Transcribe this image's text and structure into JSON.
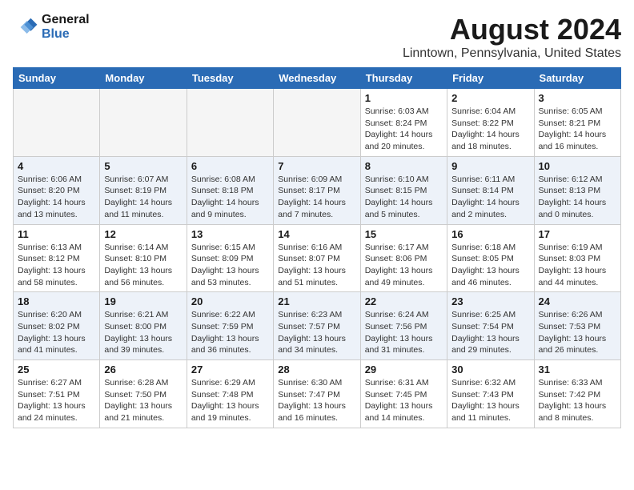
{
  "header": {
    "logo_line1": "General",
    "logo_line2": "Blue",
    "title": "August 2024",
    "subtitle": "Linntown, Pennsylvania, United States"
  },
  "days_of_week": [
    "Sunday",
    "Monday",
    "Tuesday",
    "Wednesday",
    "Thursday",
    "Friday",
    "Saturday"
  ],
  "weeks": [
    [
      {
        "day": "",
        "info": ""
      },
      {
        "day": "",
        "info": ""
      },
      {
        "day": "",
        "info": ""
      },
      {
        "day": "",
        "info": ""
      },
      {
        "day": "1",
        "info": "Sunrise: 6:03 AM\nSunset: 8:24 PM\nDaylight: 14 hours\nand 20 minutes."
      },
      {
        "day": "2",
        "info": "Sunrise: 6:04 AM\nSunset: 8:22 PM\nDaylight: 14 hours\nand 18 minutes."
      },
      {
        "day": "3",
        "info": "Sunrise: 6:05 AM\nSunset: 8:21 PM\nDaylight: 14 hours\nand 16 minutes."
      }
    ],
    [
      {
        "day": "4",
        "info": "Sunrise: 6:06 AM\nSunset: 8:20 PM\nDaylight: 14 hours\nand 13 minutes."
      },
      {
        "day": "5",
        "info": "Sunrise: 6:07 AM\nSunset: 8:19 PM\nDaylight: 14 hours\nand 11 minutes."
      },
      {
        "day": "6",
        "info": "Sunrise: 6:08 AM\nSunset: 8:18 PM\nDaylight: 14 hours\nand 9 minutes."
      },
      {
        "day": "7",
        "info": "Sunrise: 6:09 AM\nSunset: 8:17 PM\nDaylight: 14 hours\nand 7 minutes."
      },
      {
        "day": "8",
        "info": "Sunrise: 6:10 AM\nSunset: 8:15 PM\nDaylight: 14 hours\nand 5 minutes."
      },
      {
        "day": "9",
        "info": "Sunrise: 6:11 AM\nSunset: 8:14 PM\nDaylight: 14 hours\nand 2 minutes."
      },
      {
        "day": "10",
        "info": "Sunrise: 6:12 AM\nSunset: 8:13 PM\nDaylight: 14 hours\nand 0 minutes."
      }
    ],
    [
      {
        "day": "11",
        "info": "Sunrise: 6:13 AM\nSunset: 8:12 PM\nDaylight: 13 hours\nand 58 minutes."
      },
      {
        "day": "12",
        "info": "Sunrise: 6:14 AM\nSunset: 8:10 PM\nDaylight: 13 hours\nand 56 minutes."
      },
      {
        "day": "13",
        "info": "Sunrise: 6:15 AM\nSunset: 8:09 PM\nDaylight: 13 hours\nand 53 minutes."
      },
      {
        "day": "14",
        "info": "Sunrise: 6:16 AM\nSunset: 8:07 PM\nDaylight: 13 hours\nand 51 minutes."
      },
      {
        "day": "15",
        "info": "Sunrise: 6:17 AM\nSunset: 8:06 PM\nDaylight: 13 hours\nand 49 minutes."
      },
      {
        "day": "16",
        "info": "Sunrise: 6:18 AM\nSunset: 8:05 PM\nDaylight: 13 hours\nand 46 minutes."
      },
      {
        "day": "17",
        "info": "Sunrise: 6:19 AM\nSunset: 8:03 PM\nDaylight: 13 hours\nand 44 minutes."
      }
    ],
    [
      {
        "day": "18",
        "info": "Sunrise: 6:20 AM\nSunset: 8:02 PM\nDaylight: 13 hours\nand 41 minutes."
      },
      {
        "day": "19",
        "info": "Sunrise: 6:21 AM\nSunset: 8:00 PM\nDaylight: 13 hours\nand 39 minutes."
      },
      {
        "day": "20",
        "info": "Sunrise: 6:22 AM\nSunset: 7:59 PM\nDaylight: 13 hours\nand 36 minutes."
      },
      {
        "day": "21",
        "info": "Sunrise: 6:23 AM\nSunset: 7:57 PM\nDaylight: 13 hours\nand 34 minutes."
      },
      {
        "day": "22",
        "info": "Sunrise: 6:24 AM\nSunset: 7:56 PM\nDaylight: 13 hours\nand 31 minutes."
      },
      {
        "day": "23",
        "info": "Sunrise: 6:25 AM\nSunset: 7:54 PM\nDaylight: 13 hours\nand 29 minutes."
      },
      {
        "day": "24",
        "info": "Sunrise: 6:26 AM\nSunset: 7:53 PM\nDaylight: 13 hours\nand 26 minutes."
      }
    ],
    [
      {
        "day": "25",
        "info": "Sunrise: 6:27 AM\nSunset: 7:51 PM\nDaylight: 13 hours\nand 24 minutes."
      },
      {
        "day": "26",
        "info": "Sunrise: 6:28 AM\nSunset: 7:50 PM\nDaylight: 13 hours\nand 21 minutes."
      },
      {
        "day": "27",
        "info": "Sunrise: 6:29 AM\nSunset: 7:48 PM\nDaylight: 13 hours\nand 19 minutes."
      },
      {
        "day": "28",
        "info": "Sunrise: 6:30 AM\nSunset: 7:47 PM\nDaylight: 13 hours\nand 16 minutes."
      },
      {
        "day": "29",
        "info": "Sunrise: 6:31 AM\nSunset: 7:45 PM\nDaylight: 13 hours\nand 14 minutes."
      },
      {
        "day": "30",
        "info": "Sunrise: 6:32 AM\nSunset: 7:43 PM\nDaylight: 13 hours\nand 11 minutes."
      },
      {
        "day": "31",
        "info": "Sunrise: 6:33 AM\nSunset: 7:42 PM\nDaylight: 13 hours\nand 8 minutes."
      }
    ]
  ]
}
